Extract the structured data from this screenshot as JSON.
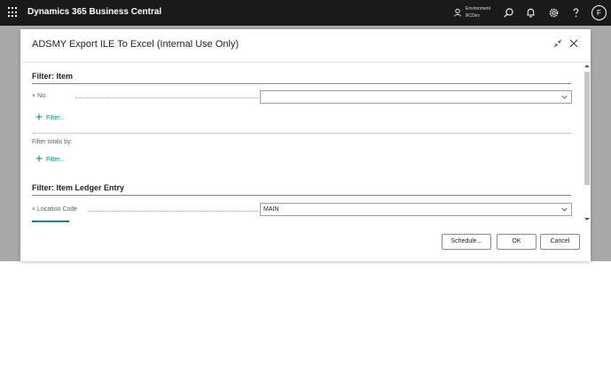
{
  "app": {
    "title": "Dynamics 365 Business Central"
  },
  "environment": {
    "label": "Environment",
    "name": "BCDev"
  },
  "user": {
    "initial": "F"
  },
  "dialog": {
    "title": "ADSMY Export ILE To Excel (Internal Use Only)",
    "sections": {
      "item": {
        "heading": "Filter: Item",
        "fields": [
          {
            "label": "× No.",
            "value": ""
          }
        ],
        "add_filter": "Filter..."
      },
      "totals": {
        "label": "Filter totals by:",
        "add_filter": "Filter..."
      },
      "ile": {
        "heading": "Filter: Item Ledger Entry",
        "fields": [
          {
            "label": "× Location Code",
            "value": "MAIN"
          }
        ]
      }
    },
    "buttons": {
      "schedule": "Schedule...",
      "ok": "OK",
      "cancel": "Cancel"
    }
  },
  "colors": {
    "topbar": "#1b1a19",
    "accent": "#00857b",
    "backdrop": "#a8a8a8"
  },
  "icons": [
    "waffle-icon",
    "environment-icon",
    "search-icon",
    "bell-icon",
    "gear-icon",
    "help-icon",
    "collapse-icon",
    "close-icon",
    "plus-icon",
    "chevron-down-icon"
  ]
}
